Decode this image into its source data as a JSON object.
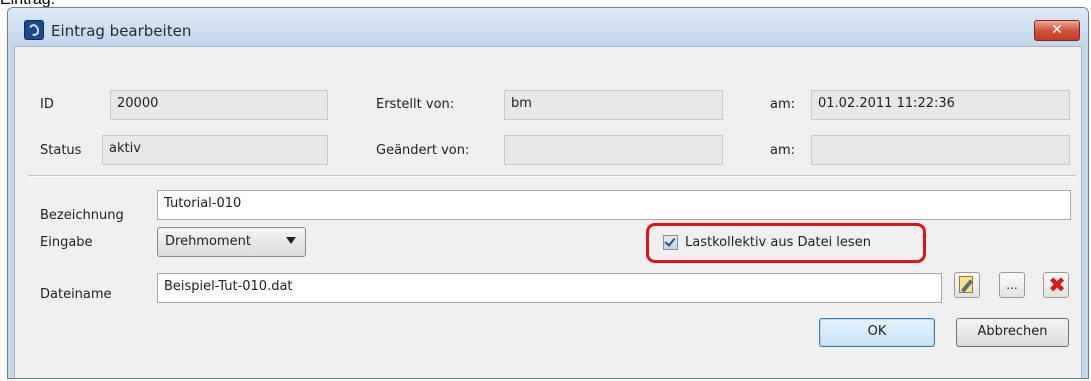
{
  "caption": "Eintrag:",
  "window": {
    "title": "Eintrag bearbeiten",
    "close_glyph": "✕"
  },
  "fields": {
    "id": {
      "label": "ID",
      "value": "20000"
    },
    "status": {
      "label": "Status",
      "value": "aktiv"
    },
    "created_by": {
      "label": "Erstellt von:",
      "value": "bm"
    },
    "changed_by": {
      "label": "Geändert von:",
      "value": ""
    },
    "created_at": {
      "label": "am:",
      "value": "01.02.2011  11:22:36"
    },
    "changed_at": {
      "label": "am:",
      "value": ""
    },
    "bezeichnung": {
      "label": "Bezeichnung",
      "value": "Tutorial-010"
    },
    "eingabe": {
      "label": "Eingabe",
      "value": "Drehmoment"
    },
    "lastkollektiv": {
      "label": "Lastkollektiv aus Datei lesen",
      "checked": true
    },
    "dateiname": {
      "label": "Dateiname",
      "value": "Beispiel-Tut-010.dat"
    }
  },
  "file_buttons": {
    "edit_icon": "edit-file-icon",
    "browse_label": "...",
    "delete_glyph": "✖"
  },
  "buttons": {
    "ok": "OK",
    "cancel": "Abbrechen"
  },
  "colors": {
    "highlight": "#e0131a",
    "frame": "#c3d6ea",
    "close": "#c13a24"
  }
}
